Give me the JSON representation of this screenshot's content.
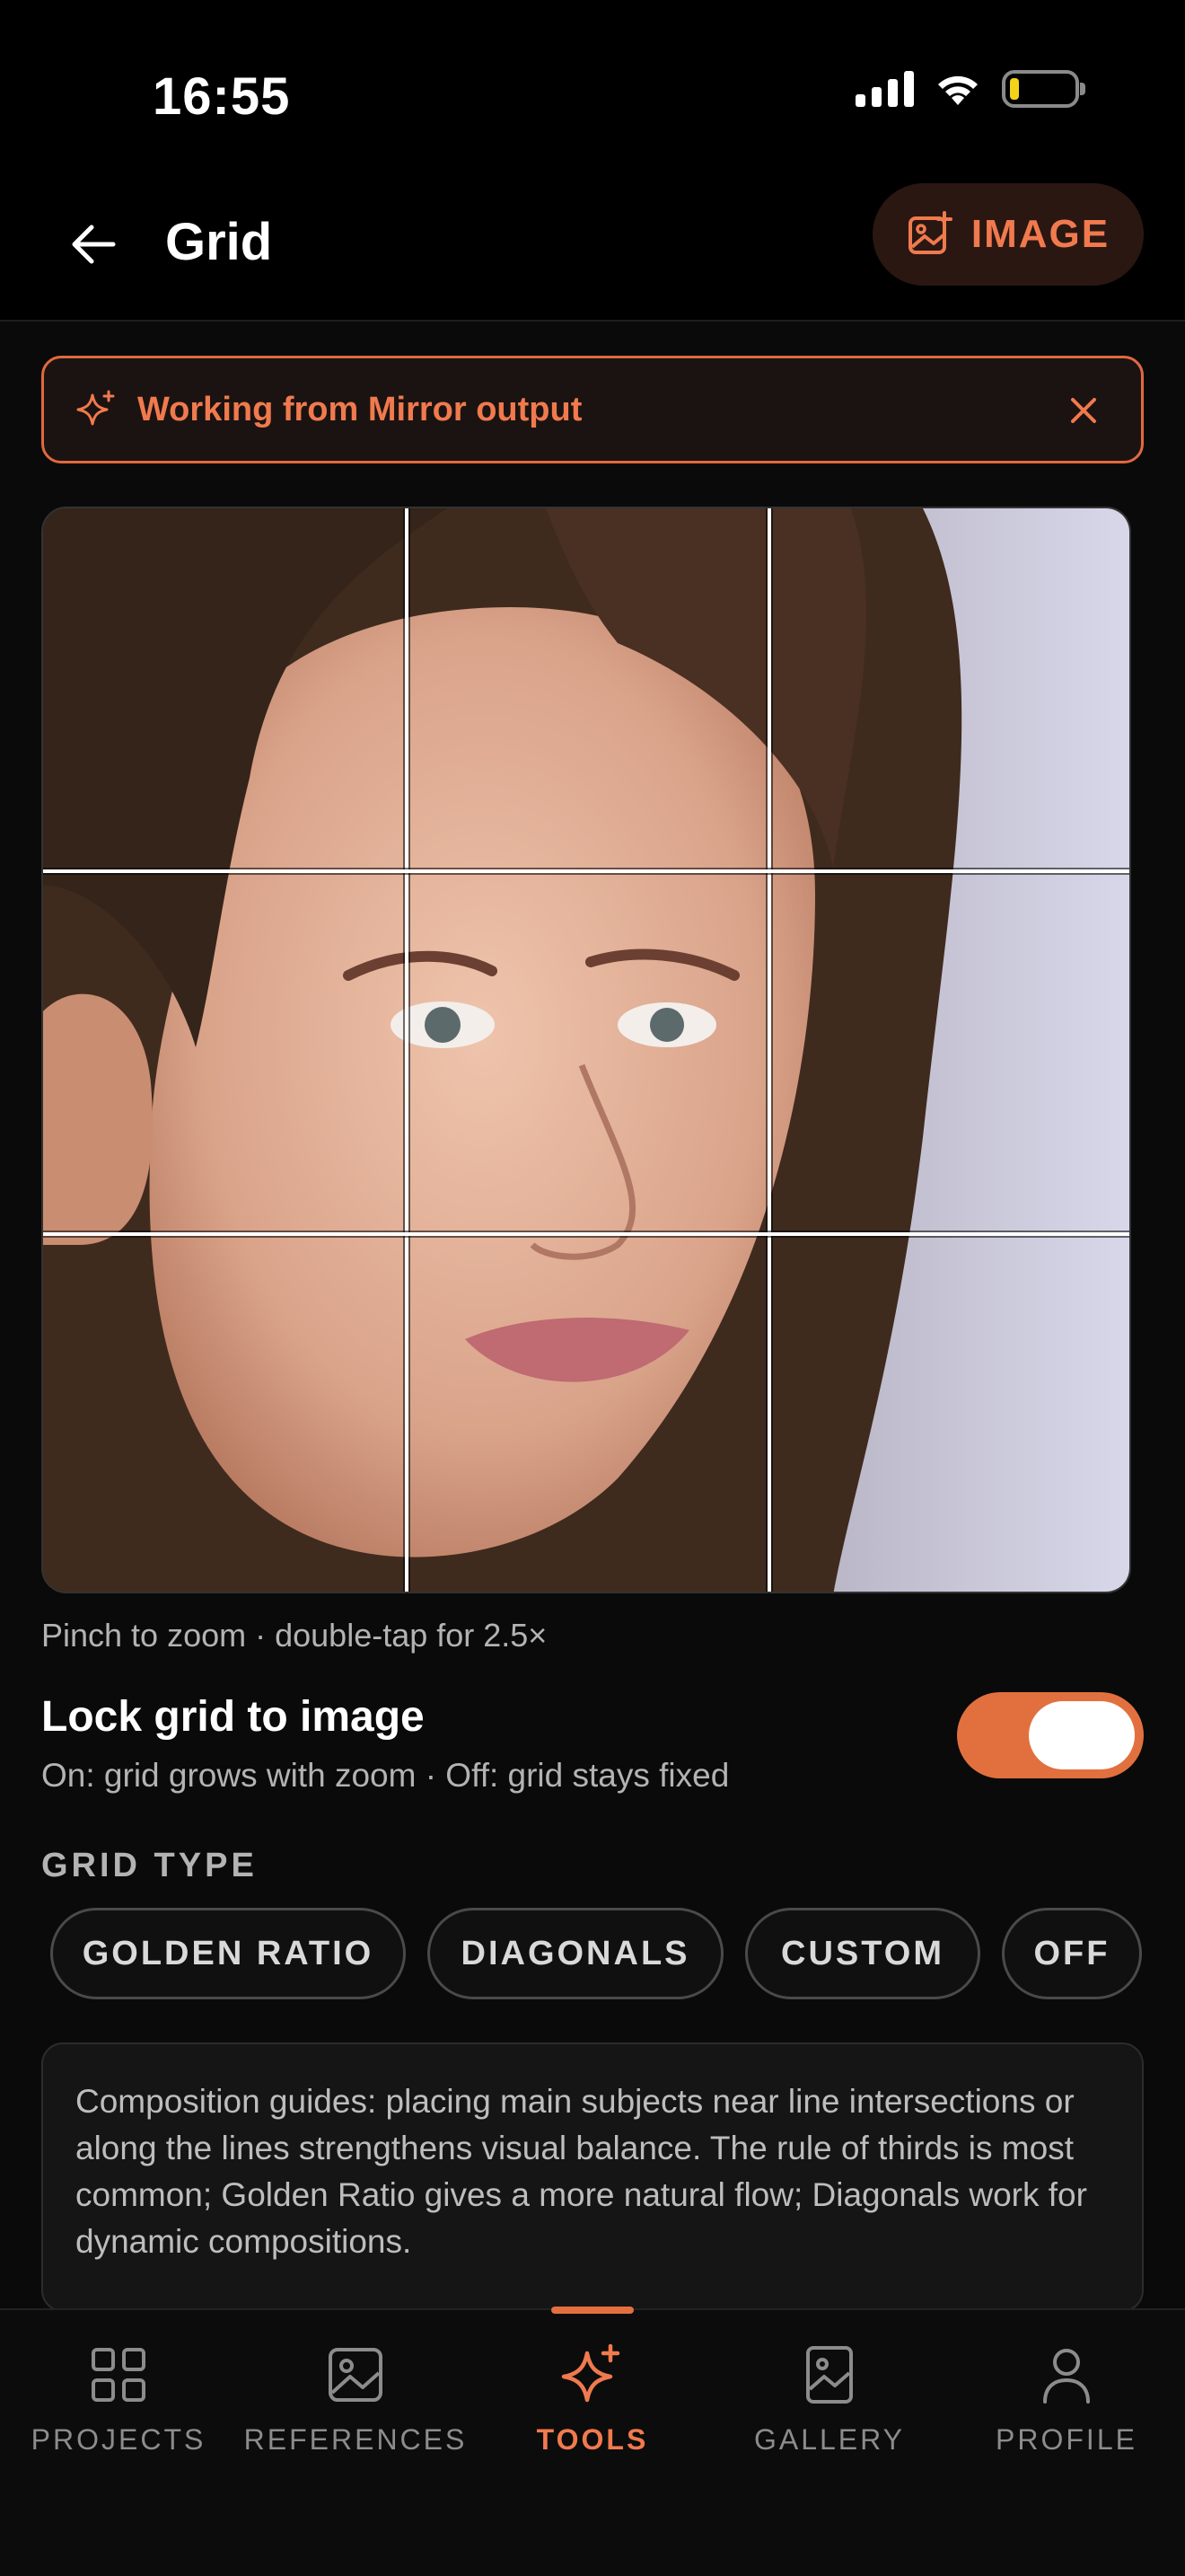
{
  "status_bar": {
    "time": "16:55"
  },
  "header": {
    "title": "Grid",
    "image_button_label": "IMAGE"
  },
  "banner": {
    "text": "Working from Mirror output"
  },
  "canvas": {
    "hint": "Pinch to zoom · double-tap for 2.5×"
  },
  "lock_grid": {
    "title": "Lock grid to image",
    "subtitle": "On: grid grows with zoom · Off: grid stays fixed",
    "enabled": true
  },
  "grid_type": {
    "label": "GRID TYPE",
    "options": [
      "GOLDEN RATIO",
      "DIAGONALS",
      "CUSTOM",
      "OFF"
    ]
  },
  "info": {
    "text": "Composition guides: placing main subjects near line intersections or along the lines strengthens visual balance. The rule of thirds is most common; Golden Ratio gives a more natural flow; Diagonals work for dynamic compositions."
  },
  "bottom_nav": {
    "items": [
      {
        "label": "PROJECTS",
        "icon": "grid-squares-icon"
      },
      {
        "label": "REFERENCES",
        "icon": "image-icon"
      },
      {
        "label": "TOOLS",
        "icon": "sparkle-icon"
      },
      {
        "label": "GALLERY",
        "icon": "gallery-icon"
      },
      {
        "label": "PROFILE",
        "icon": "person-icon"
      }
    ],
    "active": "TOOLS"
  },
  "colors": {
    "accent": "#e2703f",
    "accent_text": "#f07a4e",
    "background": "#0a0a0a"
  }
}
